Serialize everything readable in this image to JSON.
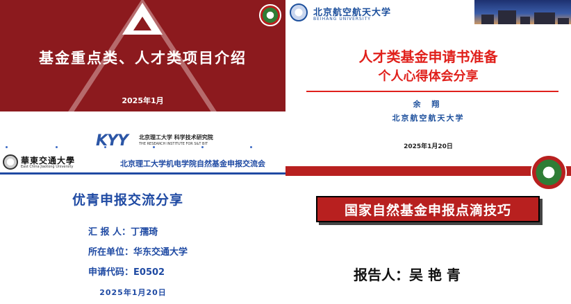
{
  "slide_kyy": {
    "title": "基金重点类、人才类项目介绍",
    "date": "2025年1月",
    "logo_text": "KYY",
    "institute_cn": "北京理工大学 科学技术研究院",
    "institute_en": "THE RESEARCH INSTITUTE FOR S&T BIT",
    "accent_color": "#8c1a1e"
  },
  "slide_beihang": {
    "university_cn": "北京航空航天大学",
    "university_en": "BEIHANG UNIVERSITY",
    "title_line1": "人才类基金申请书准备",
    "title_line2": "个人心得体会分享",
    "author": "余 翔",
    "organization": "北京航空航天大学",
    "date": "2025年1月20日",
    "accent_color": "#e0201b"
  },
  "slide_ecjtu": {
    "university_cn": "華東交通大學",
    "university_en": "East China Jiaotong University",
    "header_text": "北京理工大学机电学院自然基金申报交流会",
    "title": "优青申报交流分享",
    "rows": [
      {
        "label": "汇 报 人：",
        "value": "丁孺琦"
      },
      {
        "label": "所在单位：",
        "value": "华东交通大学"
      },
      {
        "label": "申请代码：",
        "value": "E0502"
      }
    ],
    "date": "2025年1月20日",
    "accent_color": "#1f4aa3"
  },
  "slide_nsfc_tips": {
    "banner_title": "国家自然基金申报点滴技巧",
    "reporter_label": "报告人：",
    "reporter_name": "吴 艳 青",
    "accent_color": "#b8201f"
  }
}
